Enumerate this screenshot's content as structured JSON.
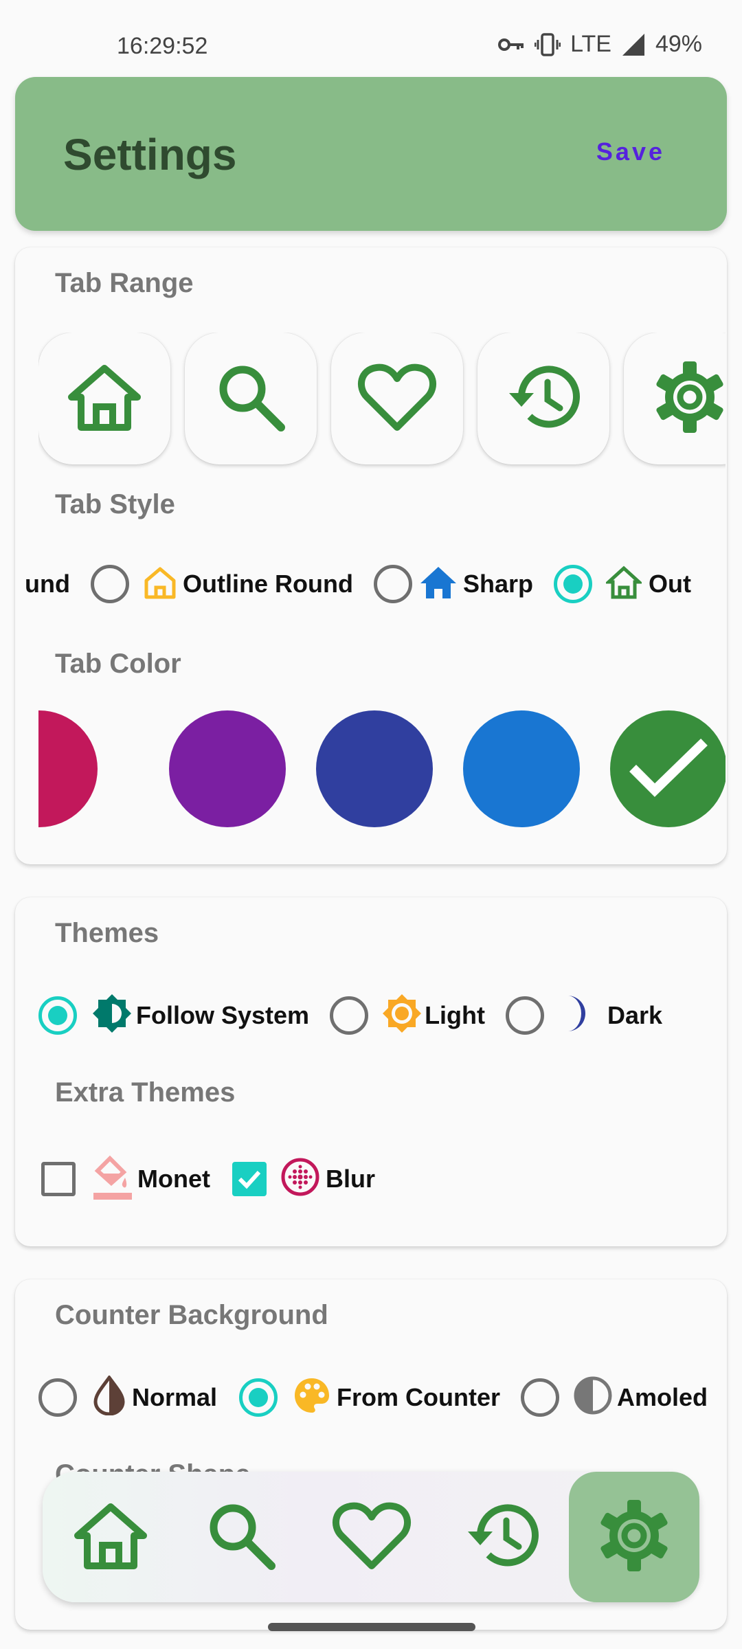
{
  "status": {
    "time": "16:29:52",
    "network": "LTE",
    "battery": "49%"
  },
  "header": {
    "title": "Settings",
    "save_label": "Save"
  },
  "tab_range": {
    "title": "Tab Range",
    "items": [
      {
        "icon": "home-outline-icon"
      },
      {
        "icon": "search-icon"
      },
      {
        "icon": "heart-outline-icon"
      },
      {
        "icon": "history-icon"
      },
      {
        "icon": "gear-icon"
      }
    ]
  },
  "tab_style": {
    "title": "Tab Style",
    "options": [
      {
        "label": "und",
        "selected": false
      },
      {
        "label": "Outline Round",
        "selected": false,
        "icon_color": "#f9b826"
      },
      {
        "label": "Sharp",
        "selected": false,
        "icon_color": "#1976d2"
      },
      {
        "label": "Out",
        "selected": true,
        "icon_color": "#388e3c"
      }
    ]
  },
  "tab_color": {
    "title": "Tab Color",
    "colors": [
      "#c2185b",
      "#7b1fa2",
      "#303f9f",
      "#1976d2",
      "#388e3c"
    ],
    "selected_index": 4
  },
  "themes": {
    "title": "Themes",
    "options": [
      {
        "label": "Follow System",
        "selected": true
      },
      {
        "label": "Light",
        "selected": false
      },
      {
        "label": "Dark",
        "selected": false
      }
    ]
  },
  "extra_themes": {
    "title": "Extra Themes",
    "options": [
      {
        "label": "Monet",
        "checked": false
      },
      {
        "label": "Blur",
        "checked": true
      }
    ]
  },
  "counter_background": {
    "title": "Counter Background",
    "options": [
      {
        "label": "Normal",
        "selected": false
      },
      {
        "label": "From Counter",
        "selected": true
      },
      {
        "label": "Amoled",
        "selected": false
      }
    ]
  },
  "counter_shape": {
    "title": "Counter Shape"
  },
  "bottom_nav": {
    "items": [
      {
        "icon": "home-outline-icon"
      },
      {
        "icon": "search-icon"
      },
      {
        "icon": "heart-outline-icon"
      },
      {
        "icon": "history-icon"
      },
      {
        "icon": "gear-icon"
      }
    ],
    "active_index": 4
  },
  "colors": {
    "accent": "#19cfc2",
    "header_bg": "#88bb88",
    "tab_green": "#388e3c"
  }
}
